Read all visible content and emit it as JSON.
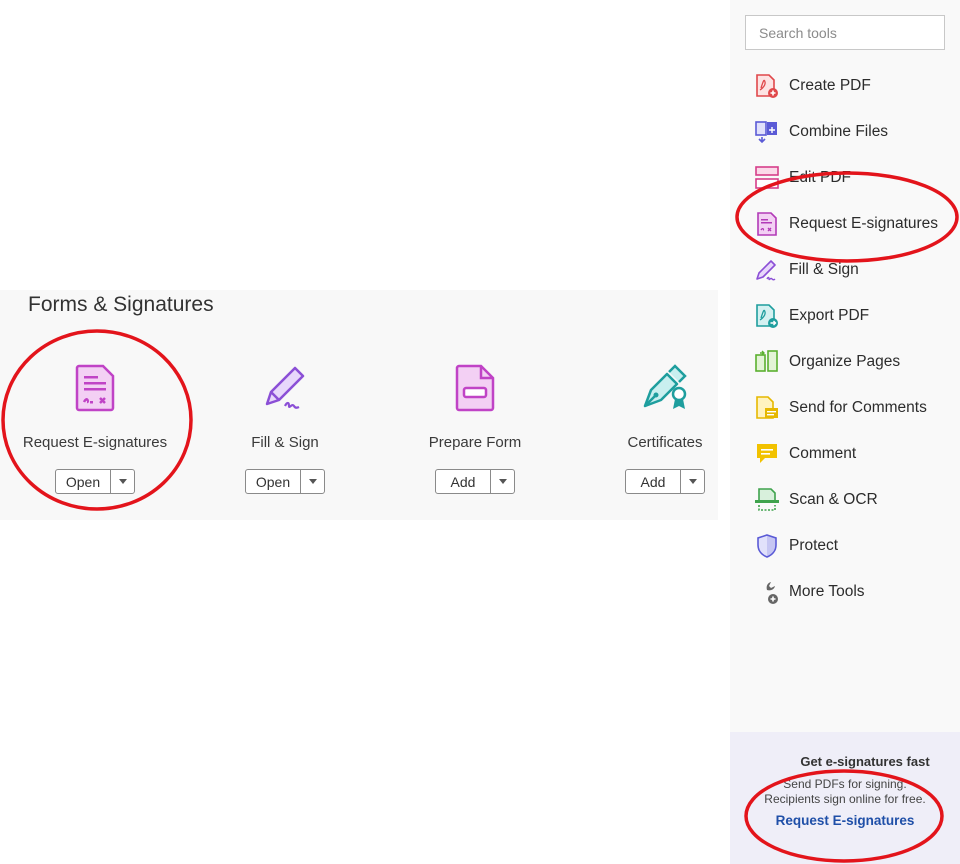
{
  "forms_section": {
    "title": "Forms & Signatures",
    "tools": [
      {
        "name": "Request E-signatures",
        "button": "Open",
        "icon": "request-esignatures-icon"
      },
      {
        "name": "Fill & Sign",
        "button": "Open",
        "icon": "fill-sign-icon"
      },
      {
        "name": "Prepare Form",
        "button": "Add",
        "icon": "prepare-form-icon"
      },
      {
        "name": "Certificates",
        "button": "Add",
        "icon": "certificates-icon"
      }
    ]
  },
  "sidebar": {
    "search_placeholder": "Search tools",
    "items": [
      {
        "label": "Create PDF",
        "icon": "create-pdf-icon",
        "color": "#e0484b"
      },
      {
        "label": "Combine Files",
        "icon": "combine-files-icon",
        "color": "#5b5bd6"
      },
      {
        "label": "Edit PDF",
        "icon": "edit-pdf-icon",
        "color": "#d63e8a"
      },
      {
        "label": "Request E-signatures",
        "icon": "request-esignatures-icon",
        "color": "#b23ab7"
      },
      {
        "label": "Fill & Sign",
        "icon": "fill-sign-icon",
        "color": "#8b4fd6"
      },
      {
        "label": "Export PDF",
        "icon": "export-pdf-icon",
        "color": "#1e9e9e"
      },
      {
        "label": "Organize Pages",
        "icon": "organize-pages-icon",
        "color": "#5bb02f"
      },
      {
        "label": "Send for Comments",
        "icon": "send-for-comments-icon",
        "color": "#e6b800"
      },
      {
        "label": "Comment",
        "icon": "comment-icon",
        "color": "#e6b800"
      },
      {
        "label": "Scan & OCR",
        "icon": "scan-ocr-icon",
        "color": "#3fa34d"
      },
      {
        "label": "Protect",
        "icon": "protect-icon",
        "color": "#5b5bd6"
      },
      {
        "label": "More Tools",
        "icon": "more-tools-icon",
        "color": "#555555"
      }
    ],
    "promo": {
      "title": "Get e-signatures fast",
      "desc_line1": "Send PDFs for signing.",
      "desc_line2": "Recipients sign online for free.",
      "link": "Request E-signatures"
    }
  },
  "colors": {
    "annotation_red": "#e3141b",
    "link_blue": "#1f4fa8",
    "esign_magenta": "#c043c6"
  }
}
